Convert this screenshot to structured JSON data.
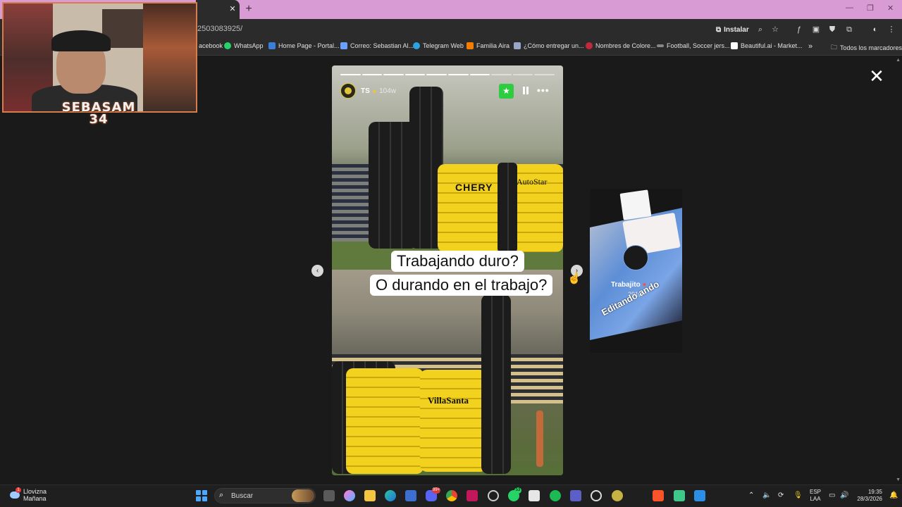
{
  "browser": {
    "url_fragment": "2503083925/",
    "install_label": "Instalar",
    "bookmarks": [
      {
        "label": "acebook",
        "icon": "facebook-icon"
      },
      {
        "label": "WhatsApp",
        "icon": "whatsapp-icon"
      },
      {
        "label": "Home Page - Portal...",
        "icon": "portal-icon"
      },
      {
        "label": "Correo: Sebastian Al...",
        "icon": "mail-icon"
      },
      {
        "label": "Telegram Web",
        "icon": "telegram-icon"
      },
      {
        "label": "Familia Aira",
        "icon": "blogger-icon"
      },
      {
        "label": "¿Cómo entregar un...",
        "icon": "doc-icon"
      },
      {
        "label": "Nombres de Colore...",
        "icon": "color-icon"
      },
      {
        "label": "Football, Soccer jers...",
        "icon": "jersey-icon"
      },
      {
        "label": "Beautiful.ai - Market...",
        "icon": "beautiful-icon"
      }
    ],
    "bookmarks_more": "»",
    "all_bookmarks": "Todos los marcadores"
  },
  "webcam": {
    "logo_line1": "SEBASAM",
    "logo_line2": "34"
  },
  "story": {
    "username": "TS",
    "age": "104w",
    "segments": 10,
    "segments_done": 7,
    "caption_line1": "Trabajando duro?",
    "caption_line2": "O durando en el trabajo?",
    "brands": [
      "CHERY",
      "AutoStar",
      "VillaSanta"
    ]
  },
  "next_story": {
    "username": "Trabajito",
    "age": "291w",
    "overlay_text": "Editando ando"
  },
  "taskbar": {
    "weather_title": "Llovizna",
    "weather_sub": "Mañana",
    "weather_badge": "1",
    "search_label": "Buscar",
    "badge_discord": "99+",
    "badge_whatsapp": "53",
    "lang_top": "ESP",
    "lang_bottom": "LAA",
    "time": "19:35",
    "date": "28/3/2026"
  },
  "colors": {
    "tabstrip": "#d99bd3",
    "star_button": "#2ecc40",
    "inflatable_yellow": "#f2d21f"
  }
}
